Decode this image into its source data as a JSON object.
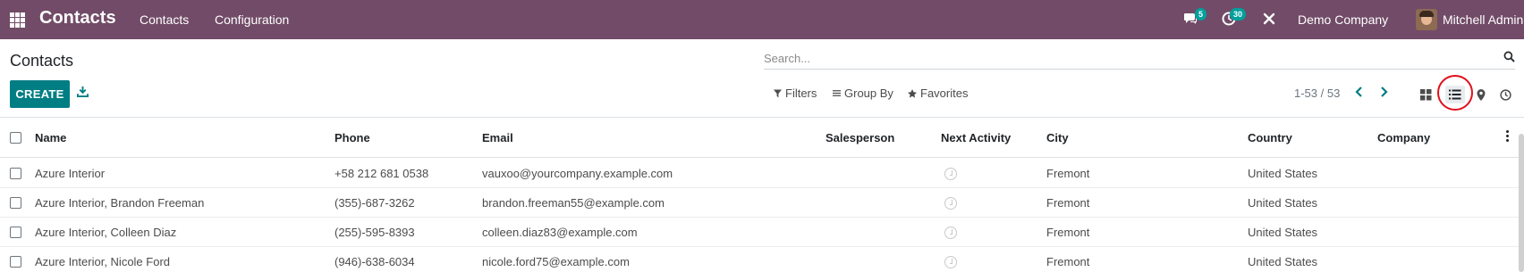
{
  "navbar": {
    "brand": "Contacts",
    "menu": [
      "Contacts",
      "Configuration"
    ],
    "messages_count": "5",
    "activities_count": "30",
    "company": "Demo Company",
    "user": "Mitchell Admin",
    "bg_color": "#714b67"
  },
  "control_panel": {
    "title": "Contacts",
    "search_placeholder": "Search...",
    "create_label": "CREATE",
    "filters_label": "Filters",
    "group_by_label": "Group By",
    "favorites_label": "Favorites",
    "pager": "1-53 / 53",
    "accent_color": "#017e84"
  },
  "table": {
    "columns": [
      "Name",
      "Phone",
      "Email",
      "Salesperson",
      "Next Activity",
      "City",
      "Country",
      "Company"
    ],
    "rows": [
      {
        "name": "Azure Interior",
        "phone": "+58 212 681 0538",
        "email": "vauxoo@yourcompany.example.com",
        "salesperson": "",
        "city": "Fremont",
        "country": "United States",
        "company": ""
      },
      {
        "name": "Azure Interior, Brandon Freeman",
        "phone": "(355)-687-3262",
        "email": "brandon.freeman55@example.com",
        "salesperson": "",
        "city": "Fremont",
        "country": "United States",
        "company": ""
      },
      {
        "name": "Azure Interior, Colleen Diaz",
        "phone": "(255)-595-8393",
        "email": "colleen.diaz83@example.com",
        "salesperson": "",
        "city": "Fremont",
        "country": "United States",
        "company": ""
      },
      {
        "name": "Azure Interior, Nicole Ford",
        "phone": "(946)-638-6034",
        "email": "nicole.ford75@example.com",
        "salesperson": "",
        "city": "Fremont",
        "country": "United States",
        "company": ""
      }
    ]
  }
}
